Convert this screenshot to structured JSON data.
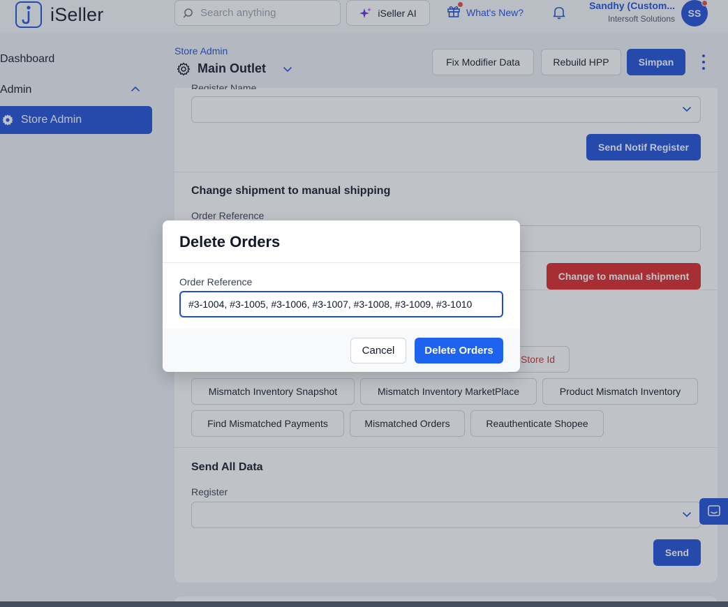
{
  "app": {
    "name": "iSeller"
  },
  "topbar": {
    "search_placeholder": "Search anything",
    "ai_label": "iSeller AI",
    "whats_new_label": "What's New?",
    "user_name": "Sandhy (Custom...",
    "user_org": "Intersoft Solutions",
    "avatar_initials": "SS"
  },
  "sidebar": {
    "items": [
      {
        "label": "Dashboard"
      },
      {
        "label": "Admin"
      },
      {
        "label": "Store Admin"
      }
    ]
  },
  "header": {
    "breadcrumb": "Store Admin",
    "title": "Main Outlet",
    "buttons": {
      "fix_modifier": "Fix Modifier Data",
      "rebuild_hpp": "Rebuild HPP",
      "save": "Simpan"
    }
  },
  "main": {
    "register_section": {
      "partial_label": "Register Name",
      "send_notif_label": "Send Notif Register"
    },
    "shipment_section": {
      "title": "Change shipment to manual shipping",
      "order_label": "Order Reference",
      "action_label": "Change to manual shipment"
    },
    "tools": {
      "partial_store_id": "Store Id",
      "row1": [
        "Mismatch Inventory Snapshot",
        "Mismatch Inventory MarketPlace",
        "Product Mismatch Inventory"
      ],
      "row2": [
        "Find Mismatched Payments",
        "Mismatched Orders",
        "Reauthenticate Shopee"
      ]
    },
    "send_all_section": {
      "title": "Send All Data",
      "register_label": "Register",
      "send_label": "Send"
    }
  },
  "modal": {
    "title": "Delete Orders",
    "field_label": "Order Reference",
    "field_value": "#3-1004, #3-1005, #3-1006, #3-1007, #3-1008, #3-1009, #3-1010",
    "cancel_label": "Cancel",
    "confirm_label": "Delete Orders"
  },
  "colors": {
    "primary": "#1d4ed8",
    "danger": "#dc2626"
  }
}
